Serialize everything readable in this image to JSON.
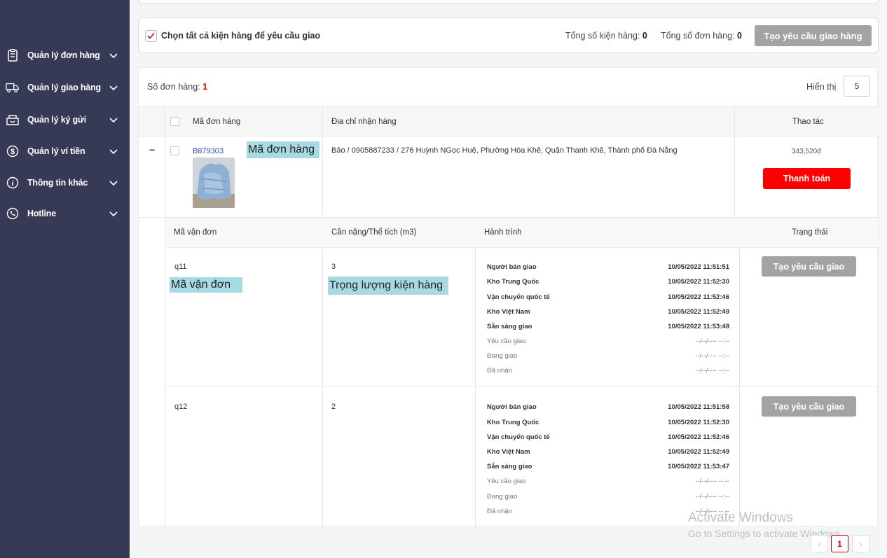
{
  "sidebar": {
    "items": [
      {
        "label": "Quản lý đơn hàng",
        "icon": "clipboard-icon"
      },
      {
        "label": "Quản lý giao hàng",
        "icon": "truck-icon"
      },
      {
        "label": "Quản lý ký gửi",
        "icon": "consignment-box-icon"
      },
      {
        "label": "Quản lý ví tiền",
        "icon": "dollar-icon"
      },
      {
        "label": "Thông tin khác",
        "icon": "info-icon"
      },
      {
        "label": "Hotline",
        "icon": "phone-icon"
      }
    ]
  },
  "select_bar": {
    "label": "Chọn tất cả kiện hàng để yêu cầu giao",
    "total_packages_label": "Tổng số kiện hàng:",
    "total_packages": "0",
    "total_orders_label": "Tổng số đơn hàng:",
    "total_orders": "0",
    "create_button": "Tạo yêu cầu giao hàng"
  },
  "orders": {
    "count_label": "Số đơn hàng:",
    "count": "1",
    "display_label": "Hiển thị",
    "display_value": "5",
    "columns": {
      "order_code": "Mã đơn hàng",
      "address": "Địa chỉ nhận hàng",
      "actions": "Thao tác"
    },
    "order": {
      "expand_symbol": "−",
      "code": "B879303",
      "annotation": "Mã đơn hàng",
      "address": "Bảo / 0905887233 / 276 Huỳnh NGọc Huệ, Phường Hòa Khê, Quận Thanh Khê, Thành phố Đà Nẵng",
      "amount": "343,520đ",
      "pay_button": "Thanh toán"
    },
    "sub_columns": {
      "waybill": "Mã vận đơn",
      "weight": "Cân nặng/Thể tích (m3)",
      "journey": "Hành trình",
      "status": "Trạng thái"
    },
    "annotations": {
      "waybill": "Mã vận đơn",
      "weight": "Trọng lượng kiện hàng"
    },
    "packages": [
      {
        "waybill": "q11",
        "weight": "3",
        "request_button": "Tạo yêu cầu giao",
        "journey": [
          {
            "step": "Người bán giao",
            "time": "10/05/2022 11:51:51"
          },
          {
            "step": "Kho Trung Quốc",
            "time": "10/05/2022 11:52:30"
          },
          {
            "step": "Vận chuyển quốc tế",
            "time": "10/05/2022 11:52:46"
          },
          {
            "step": "Kho Việt Nam",
            "time": "10/05/2022 11:52:49"
          },
          {
            "step": "Sẵn sàng giao",
            "time": "10/05/2022 11:53:48"
          },
          {
            "step": "Yêu cầu giao",
            "time": "--/--/---- --:--"
          },
          {
            "step": "Đang giao",
            "time": "--/--/---- --:--"
          },
          {
            "step": "Đã nhận",
            "time": "--/--/---- --:--"
          }
        ]
      },
      {
        "waybill": "q12",
        "weight": "2",
        "request_button": "Tạo yêu cầu giao",
        "journey": [
          {
            "step": "Người bán giao",
            "time": "10/05/2022 11:51:58"
          },
          {
            "step": "Kho Trung Quốc",
            "time": "10/05/2022 11:52:30"
          },
          {
            "step": "Vận chuyển quốc tế",
            "time": "10/05/2022 11:52:46"
          },
          {
            "step": "Kho Việt Nam",
            "time": "10/05/2022 11:52:49"
          },
          {
            "step": "Sẵn sàng giao",
            "time": "10/05/2022 11:53:47"
          },
          {
            "step": "Yêu cầu giao",
            "time": "--/--/---- --:--"
          },
          {
            "step": "Đang giao",
            "time": "--/--/---- --:--"
          },
          {
            "step": "Đã nhận",
            "time": "--/--/---- --:--"
          }
        ]
      }
    ]
  },
  "pagination": {
    "prev": "‹",
    "current": "1",
    "next": "›"
  },
  "watermark": {
    "line1": "Activate Windows",
    "line2": "Go to Settings to activate Windows."
  },
  "colors": {
    "sidebar_bg": "#363a55",
    "primary_red": "#ff0000",
    "disabled_grey": "#a3a3a3",
    "order_link": "#2a4db8",
    "annotation_bg": "#a8dae4"
  }
}
